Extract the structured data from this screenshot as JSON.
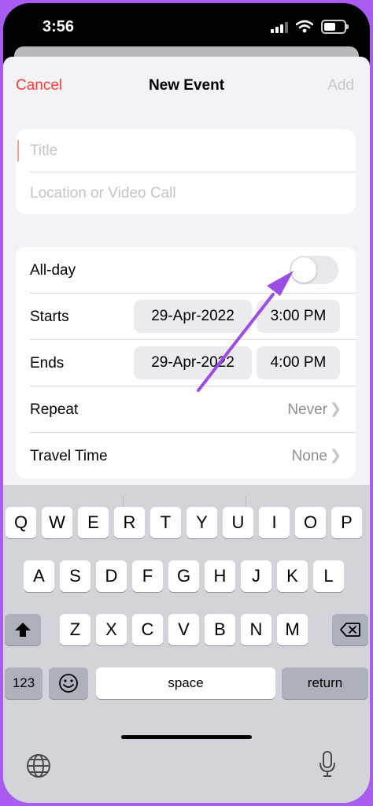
{
  "status_bar": {
    "time": "3:56"
  },
  "nav": {
    "cancel": "Cancel",
    "title": "New Event",
    "add": "Add"
  },
  "fields": {
    "title_placeholder": "Title",
    "location_placeholder": "Location or Video Call"
  },
  "event": {
    "all_day_label": "All-day",
    "all_day_on": false,
    "starts_label": "Starts",
    "starts_date": "29-Apr-2022",
    "starts_time": "3:00 PM",
    "ends_label": "Ends",
    "ends_date": "29-Apr-2022",
    "ends_time": "4:00 PM",
    "repeat_label": "Repeat",
    "repeat_value": "Never",
    "travel_label": "Travel Time",
    "travel_value": "None"
  },
  "keyboard": {
    "row1": [
      "Q",
      "W",
      "E",
      "R",
      "T",
      "Y",
      "U",
      "I",
      "O",
      "P"
    ],
    "row2": [
      "A",
      "S",
      "D",
      "F",
      "G",
      "H",
      "J",
      "K",
      "L"
    ],
    "row3": [
      "Z",
      "X",
      "C",
      "V",
      "B",
      "N",
      "M"
    ],
    "numbers": "123",
    "space": "space",
    "return": "return"
  },
  "colors": {
    "accent": "#ff3b30",
    "arrow": "#9b4de6",
    "frame": "#a95cf2"
  },
  "icons": [
    "signal-icon",
    "wifi-icon",
    "battery-icon",
    "shift-icon",
    "backspace-icon",
    "emoji-icon",
    "globe-icon",
    "mic-icon",
    "chevron-right-icon"
  ]
}
